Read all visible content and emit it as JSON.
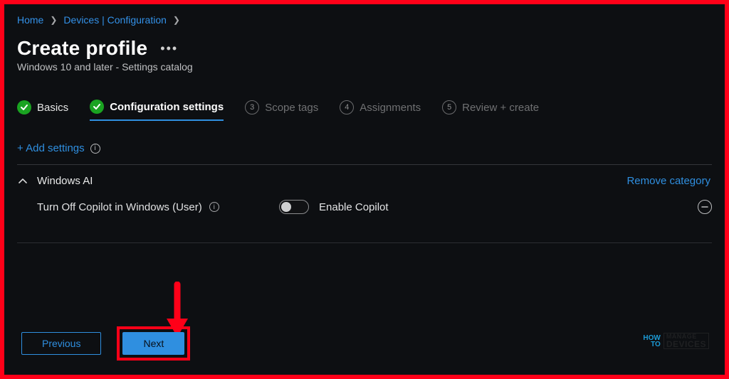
{
  "breadcrumb": {
    "home": "Home",
    "devices": "Devices | Configuration"
  },
  "header": {
    "title": "Create profile",
    "subtitle": "Windows 10 and later - Settings catalog"
  },
  "steps": {
    "s1": "Basics",
    "s2": "Configuration settings",
    "s3_num": "3",
    "s3": "Scope tags",
    "s4_num": "4",
    "s4": "Assignments",
    "s5_num": "5",
    "s5": "Review + create"
  },
  "add_settings": "+ Add settings",
  "category": {
    "name": "Windows AI",
    "remove": "Remove category",
    "setting_label": "Turn Off Copilot in Windows (User)",
    "toggle_state_label": "Enable Copilot"
  },
  "footer": {
    "previous": "Previous",
    "next": "Next"
  },
  "watermark": {
    "how": "HOW",
    "to": "TO",
    "manage": "MANAGE",
    "devices": "DEVICES"
  }
}
